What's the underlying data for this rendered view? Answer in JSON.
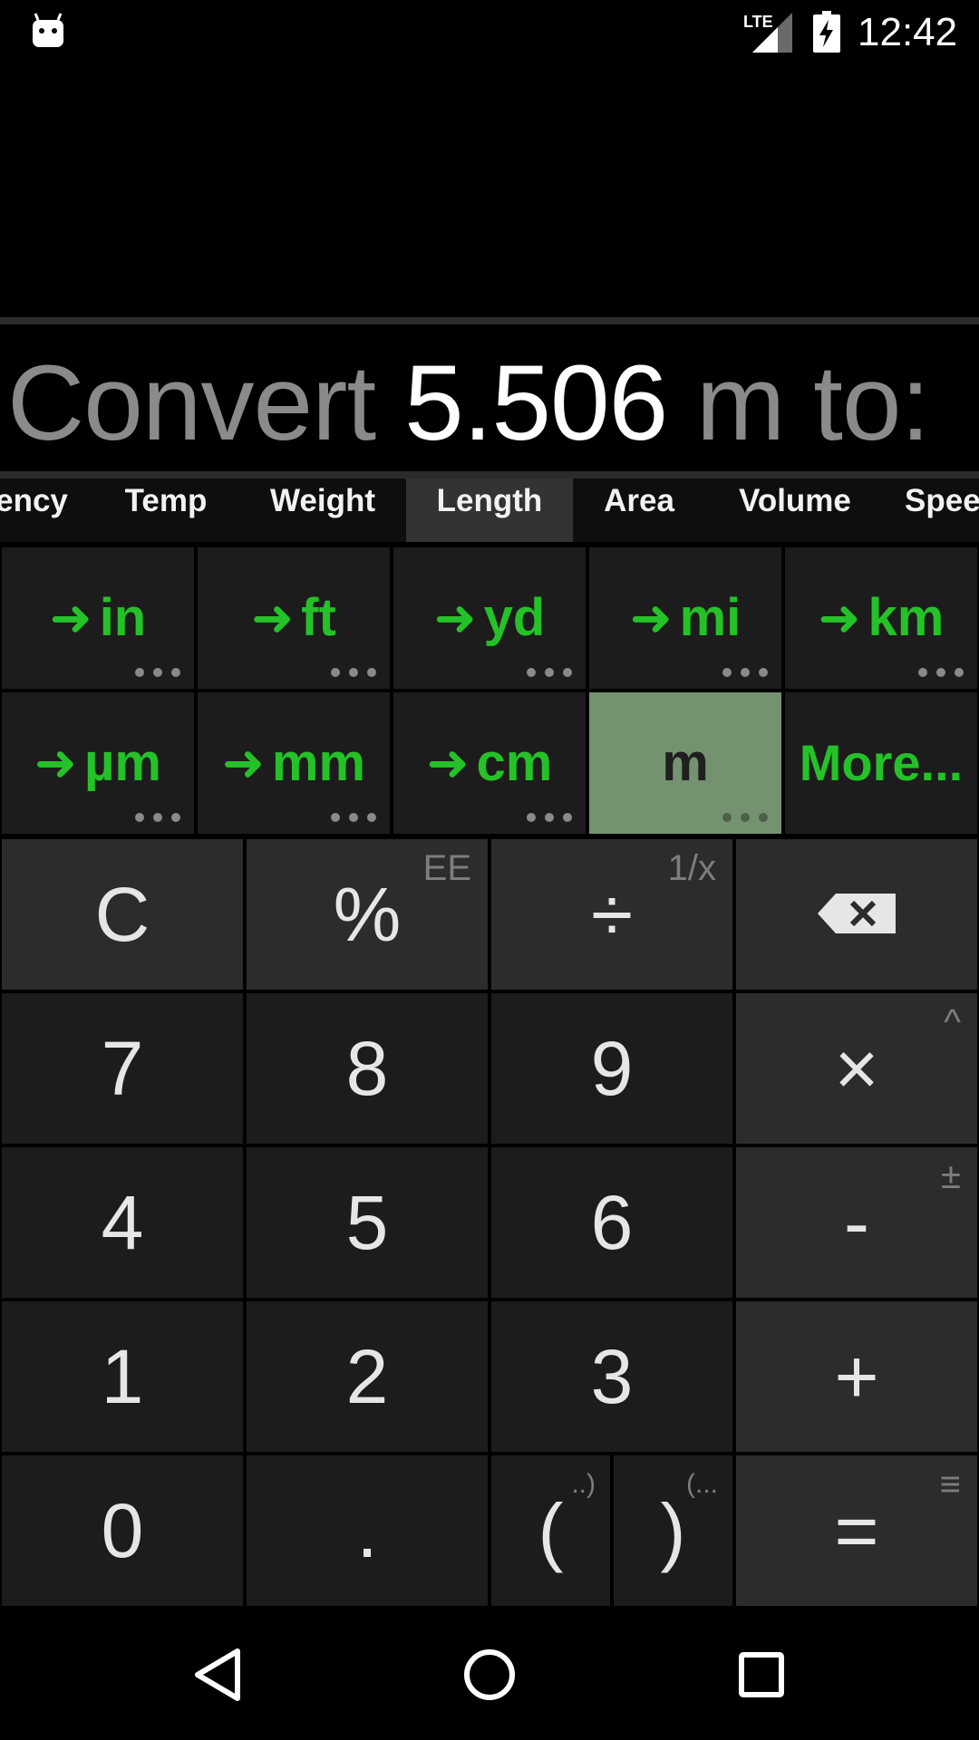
{
  "status": {
    "time": "12:42",
    "network": "LTE"
  },
  "display": {
    "prefix": "Convert ",
    "value": "5.506",
    "suffix": " m to:"
  },
  "tabs": [
    {
      "label": "ency"
    },
    {
      "label": "Temp"
    },
    {
      "label": "Weight"
    },
    {
      "label": "Length",
      "active": true
    },
    {
      "label": "Area"
    },
    {
      "label": "Volume"
    },
    {
      "label": "Spee"
    }
  ],
  "units": {
    "arrow": "➜",
    "row1": [
      "in",
      "ft",
      "yd",
      "mi",
      "km"
    ],
    "row2": [
      "µm",
      "mm",
      "cm"
    ],
    "current": "m",
    "more": "More..."
  },
  "keys": {
    "clear": "C",
    "percent": "%",
    "percent_sub": "EE",
    "divide": "÷",
    "divide_sub": "1/x",
    "seven": "7",
    "eight": "8",
    "nine": "9",
    "multiply": "×",
    "multiply_sub": "^",
    "four": "4",
    "five": "5",
    "six": "6",
    "minus": "-",
    "minus_sub": "±",
    "one": "1",
    "two": "2",
    "three": "3",
    "plus": "+",
    "zero": "0",
    "dot": ".",
    "open_paren": "(",
    "open_paren_sub": "..)",
    "close_paren": ")",
    "close_paren_sub": "(...",
    "equals": "=",
    "equals_sub": "≡"
  },
  "colors": {
    "accent_green": "#24c228",
    "selected_unit": "#749270",
    "key_bg": "#1c1c1c",
    "function_key_bg": "#2c2c2c"
  }
}
